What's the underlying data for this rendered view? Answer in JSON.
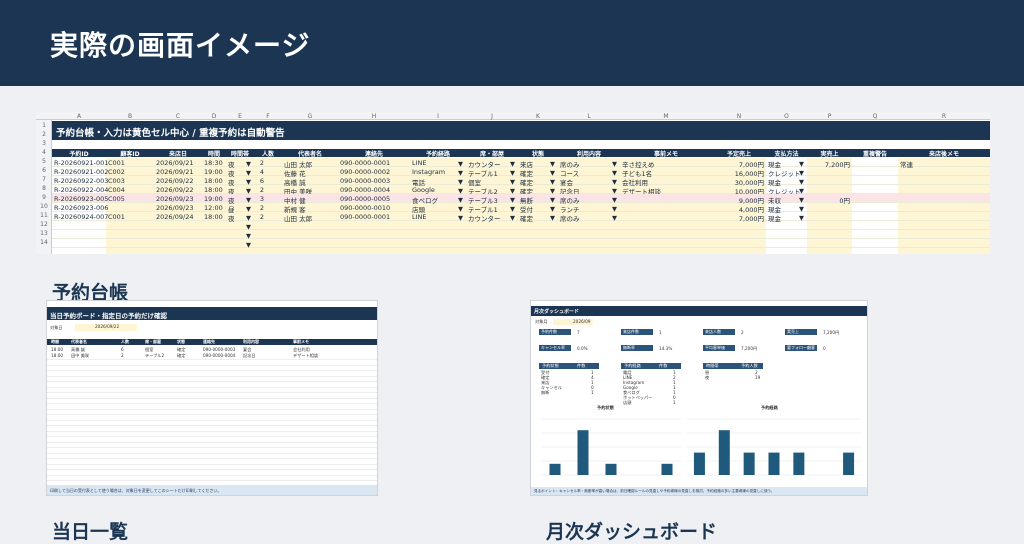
{
  "header": {
    "title": "実際の画面イメージ"
  },
  "sheet": {
    "columns": [
      "A",
      "B",
      "C",
      "D",
      "E",
      "F",
      "G",
      "H",
      "I",
      "J",
      "K",
      "L",
      "M",
      "N",
      "O",
      "P",
      "Q",
      "R"
    ],
    "rows": [
      "1",
      "2",
      "3",
      "4",
      "5",
      "6",
      "7",
      "8",
      "9",
      "10",
      "11",
      "12",
      "13",
      "14"
    ],
    "title": "予約台帳・入力は黄色セル中心 / 重複予約は自動警告",
    "headers": [
      "予約ID",
      "顧客ID",
      "来店日",
      "時間",
      "時間帯",
      "人数",
      "代表者名",
      "連絡先",
      "予約経路",
      "席・部屋",
      "状態",
      "利用内容",
      "事前メモ",
      "予定売上",
      "支払方法",
      "実売上",
      "重複警告",
      "来店後メモ"
    ],
    "data": [
      [
        "R-20260921-001",
        "C001",
        "2026/09/21",
        "18:30",
        "夜",
        "2",
        "山田 太郎",
        "090-0000-0001",
        "LINE",
        "カウンター",
        "来店",
        "席のみ",
        "辛さ控えめ",
        "7,000円",
        "現金",
        "7,200円",
        "",
        "常連"
      ],
      [
        "R-20260921-002",
        "C002",
        "2026/09/21",
        "19:00",
        "夜",
        "4",
        "佐藤 花",
        "090-0000-0002",
        "Instagram",
        "テーブル1",
        "確定",
        "コース",
        "子ども1名",
        "16,000円",
        "クレジット",
        "",
        "",
        ""
      ],
      [
        "R-20260922-003",
        "C003",
        "2026/09/22",
        "18:00",
        "夜",
        "6",
        "高橋 誠",
        "090-0000-0003",
        "電話",
        "個室",
        "確定",
        "宴会",
        "会社利用",
        "30,000円",
        "現金",
        "",
        "",
        ""
      ],
      [
        "R-20260922-004",
        "C004",
        "2026/09/22",
        "18:00",
        "夜",
        "2",
        "田中 美咲",
        "090-0000-0004",
        "Google",
        "テーブル2",
        "確定",
        "記念日",
        "デザート相談",
        "10,000円",
        "クレジット",
        "",
        "",
        ""
      ],
      [
        "R-20260923-005",
        "C005",
        "2026/09/23",
        "19:00",
        "夜",
        "3",
        "中村 健",
        "090-0000-0005",
        "食べログ",
        "テーブル3",
        "無断",
        "席のみ",
        "",
        "9,000円",
        "未収",
        "0円",
        "",
        ""
      ],
      [
        "R-20260923-006",
        "",
        "2026/09/23",
        "12:00",
        "昼",
        "2",
        "新規 客",
        "090-0000-0010",
        "店頭",
        "テーブル1",
        "受付",
        "ランチ",
        "",
        "4,000円",
        "現金",
        "",
        "",
        ""
      ],
      [
        "R-20260924-007",
        "C001",
        "2026/09/24",
        "18:00",
        "夜",
        "2",
        "山田 太郎",
        "090-0000-0001",
        "LINE",
        "カウンター",
        "確定",
        "席のみ",
        "",
        "7,000円",
        "現金",
        "",
        "",
        ""
      ]
    ]
  },
  "captions": {
    "ledger": "予約台帳",
    "today": "当日一覧",
    "monthly": "月次ダッシュボード"
  },
  "today": {
    "title": "当日予約ボード・指定日の予約だけ確認",
    "date_label": "対象日",
    "date_value": "2026/09/22",
    "headers": [
      "時間",
      "代表者名",
      "人数",
      "席・部屋",
      "状態",
      "連絡先",
      "利用内容",
      "事前メモ"
    ],
    "rows": [
      [
        "18:00",
        "高橋 誠",
        "6",
        "個室",
        "確定",
        "090-0000-0003",
        "宴会",
        "会社利用"
      ],
      [
        "18:00",
        "田中 美咲",
        "2",
        "テーブル2",
        "確定",
        "090-0000-0004",
        "記念日",
        "デザート相談"
      ]
    ],
    "footer": "印刷して当日の受付表として使う場合は、対象日を変更してこのシートだけ印刷してください。"
  },
  "monthly": {
    "title": "月次ダッシュボード",
    "month_label": "対象月",
    "month_value": "2026/09",
    "kpis": [
      {
        "label": "予約件数",
        "value": "7"
      },
      {
        "label": "来店件数",
        "value": "1"
      },
      {
        "label": "来店人数",
        "value": "2"
      },
      {
        "label": "実売上",
        "value": "7,200円"
      },
      {
        "label": "キャンセル率",
        "value": "0.0%"
      },
      {
        "label": "無断率",
        "value": "14.3%"
      },
      {
        "label": "平均客単価",
        "value": "7,200円"
      },
      {
        "label": "要フォロー顧客",
        "value": "0"
      }
    ],
    "t1": {
      "h1": "予約状態",
      "h2": "件数",
      "rows": [
        "受付",
        "確定",
        "来店",
        "キャンセル",
        "無断"
      ],
      "vals": [
        "1",
        "4",
        "1",
        "0",
        "1"
      ]
    },
    "t2": {
      "h1": "予約経路",
      "h2": "件数",
      "rows": [
        "電話",
        "LINE",
        "Instagram",
        "Google",
        "食べログ",
        "ホットペッパー",
        "店頭"
      ],
      "vals": [
        "1",
        "2",
        "1",
        "1",
        "1",
        "0",
        "1"
      ]
    },
    "t3": {
      "h1": "時間帯",
      "h2": "予約人数",
      "rows": [
        "昼",
        "夜"
      ],
      "vals": [
        "2",
        "19"
      ]
    },
    "chart1": {
      "title": "予約状態",
      "values": [
        1,
        4,
        1,
        0,
        1
      ]
    },
    "chart2": {
      "title": "予約経路",
      "values": [
        1,
        2,
        1,
        1,
        1,
        0,
        1
      ]
    },
    "footer": "見るポイント：キャンセル率・無断率が高い場合は、前日確認ルールの見直しや予約導線の見直しを検討。予約経路の多い主要導線の見直しに使う。"
  }
}
